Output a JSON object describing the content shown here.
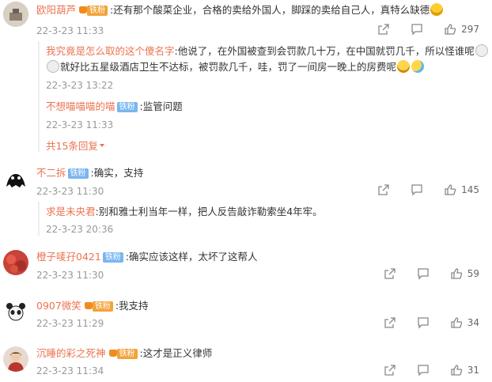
{
  "comments": [
    {
      "user": "欧阳葫芦",
      "badge": "铁粉",
      "text": ":还有那个酸菜企业，合格的卖给外国人，脚踩的卖给自己人，真特么缺德",
      "time": "22-3-23 11:33",
      "likes": "297",
      "replies": [
        {
          "user": "我究竟是怎么取的这个傻名字",
          "text1": ":他说了，在外国被查到会罚款几十万，在中国就罚几千，所以怪谁呢",
          "text2": "就好比五星级酒店卫生不达标，被罚款几千，哇，罚了一间房一晚上的房费呢",
          "time": "22-3-23 13:22"
        },
        {
          "user": "不想喵喵喵的喵",
          "badge": "铁粉",
          "text": ":监管问题",
          "time": "22-3-23 11:33"
        }
      ],
      "more": "共15条回复"
    },
    {
      "user": "不二拆",
      "badge": "铁粉",
      "text": ":确实，支持",
      "time": "22-3-23 11:30",
      "likes": "145",
      "replies": [
        {
          "user": "求是未央君",
          "text": ":别和雅士利当年一样，把人反告敲诈勒索坐4年牢。",
          "time": "22-3-23 20:36"
        }
      ]
    },
    {
      "user": "橙子唛孖0421",
      "badge": "铁粉",
      "text": ":确实应该这样，太坏了这帮人",
      "time": "22-3-23 11:30",
      "likes": "59"
    },
    {
      "user": "0907微笑",
      "badge": "铁粉",
      "text": ":我支持",
      "time": "22-3-23 11:29",
      "likes": "34"
    },
    {
      "user": "沉睡的彩之死神",
      "badge": "铁粉",
      "text": ":这才是正义律师",
      "time": "22-3-23 11:34",
      "likes": "31"
    }
  ],
  "colors": {
    "username": "#eb7350",
    "badge": "#7ab6f0",
    "meta": "#999999"
  },
  "icons": [
    "share-icon",
    "comment-icon",
    "like-icon",
    "chevron-down-icon"
  ]
}
